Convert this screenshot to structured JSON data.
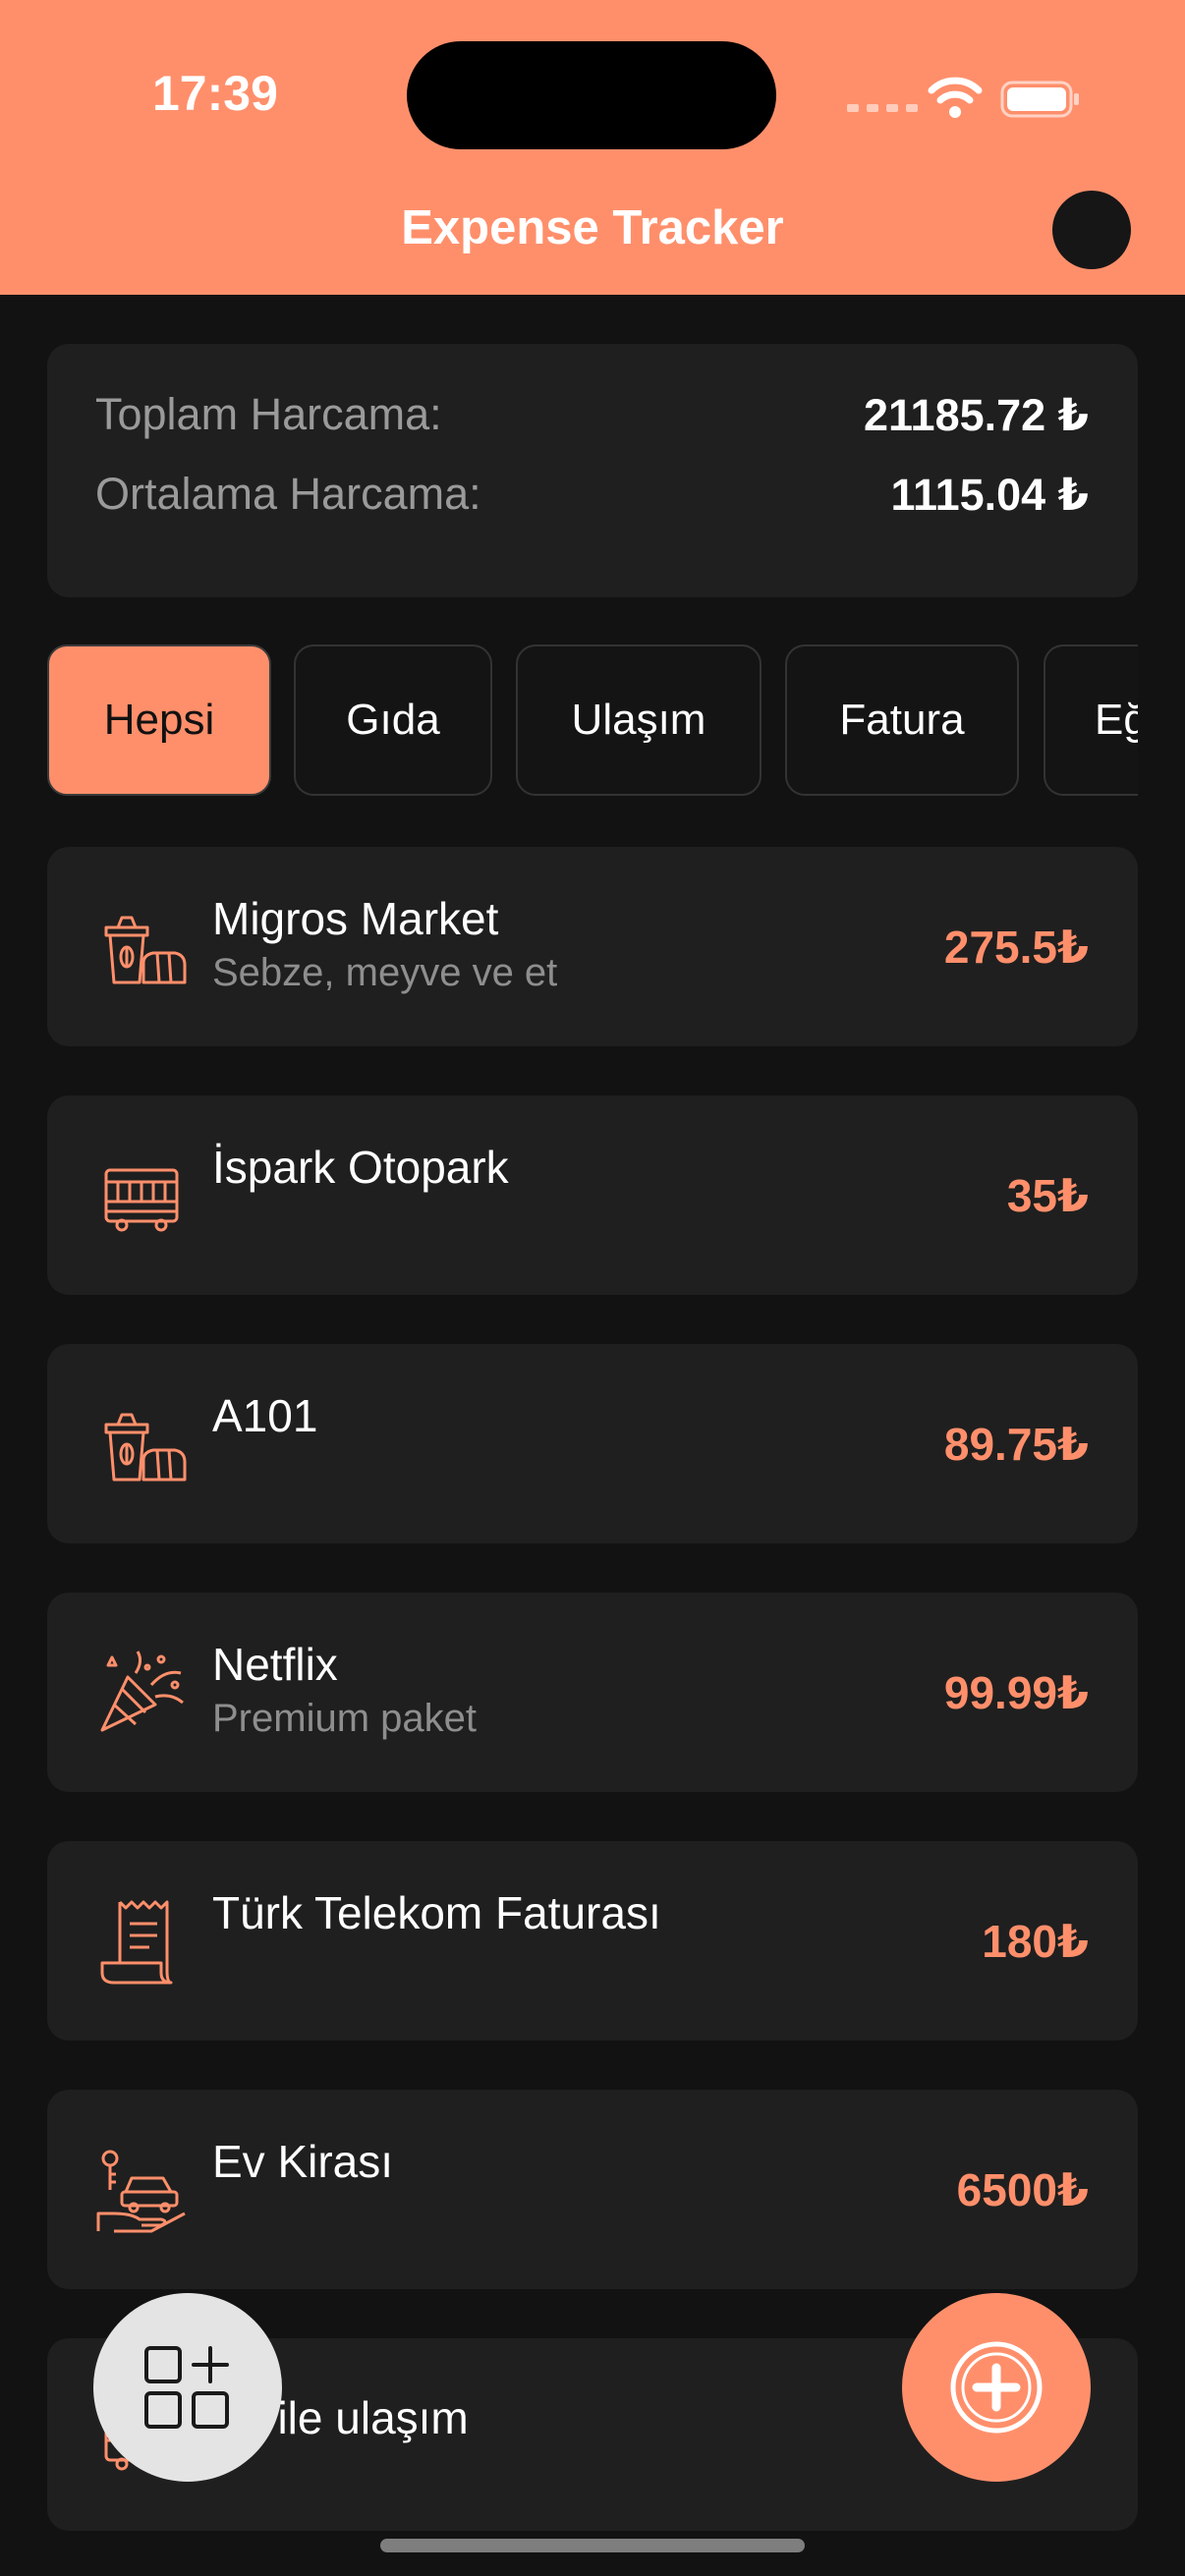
{
  "status_bar": {
    "time": "17:39"
  },
  "header": {
    "title": "Expense Tracker"
  },
  "summary": {
    "total_label": "Toplam Harcama:",
    "total_value": "21185.72 ₺",
    "average_label": "Ortalama Harcama:",
    "average_value": "1115.04 ₺"
  },
  "filters": [
    "Hepsi",
    "Gıda",
    "Ulaşım",
    "Fatura",
    "Eğ"
  ],
  "expenses": [
    {
      "title": "Migros Market",
      "subtitle": "Sebze, meyve ve et",
      "amount": "275.5₺",
      "icon": "grocery-icon"
    },
    {
      "title": "İspark Otopark",
      "subtitle": "",
      "amount": "35₺",
      "icon": "bus-icon"
    },
    {
      "title": "A101",
      "subtitle": "",
      "amount": "89.75₺",
      "icon": "grocery-icon"
    },
    {
      "title": "Netflix",
      "subtitle": "Premium paket",
      "amount": "99.99₺",
      "icon": "party-popper-icon"
    },
    {
      "title": "Türk Telekom Faturası",
      "subtitle": "",
      "amount": "180₺",
      "icon": "receipt-icon"
    },
    {
      "title": "Ev Kirası",
      "subtitle": "",
      "amount": "6500₺",
      "icon": "rent-icon"
    },
    {
      "title": "tro ile ulaşım",
      "subtitle": "",
      "amount": "",
      "icon": "bus-icon"
    }
  ],
  "colors": {
    "accent": "#FF8F6B",
    "background": "#121212",
    "card": "#1F1F1F"
  },
  "fab": {
    "left_icon": "categories-add-icon",
    "right_icon": "add-circle-icon"
  }
}
